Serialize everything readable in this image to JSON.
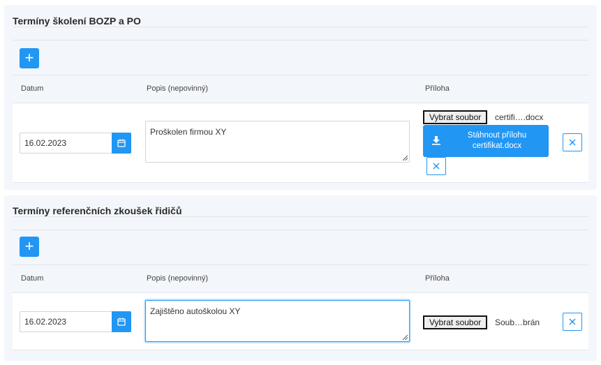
{
  "sections": [
    {
      "title": "Termíny školení BOZP a PO",
      "add_label": "+",
      "columns": {
        "date": "Datum",
        "description": "Popis (nepovinný)",
        "attachment": "Příloha"
      },
      "row": {
        "date": "16.02.2023",
        "description": "Proškolen firmou XY",
        "file_button": "Vybrat soubor",
        "file_name": "certifi….docx",
        "download_line1": "Stáhnout přílohu",
        "download_line2": "certifikat.docx"
      }
    },
    {
      "title": "Termíny referenčních zkoušek řidičů",
      "add_label": "+",
      "columns": {
        "date": "Datum",
        "description": "Popis (nepovinný)",
        "attachment": "Příloha"
      },
      "row": {
        "date": "16.02.2023",
        "description": "Zajištěno autoškolou XY",
        "file_button": "Vybrat soubor",
        "file_name": "Soub…brán"
      }
    }
  ],
  "colors": {
    "accent": "#2196f3",
    "panel_bg": "#f3f6fa"
  },
  "icons": {
    "add": "plus-icon",
    "calendar": "calendar-icon",
    "download": "download-icon",
    "remove": "close-icon"
  }
}
